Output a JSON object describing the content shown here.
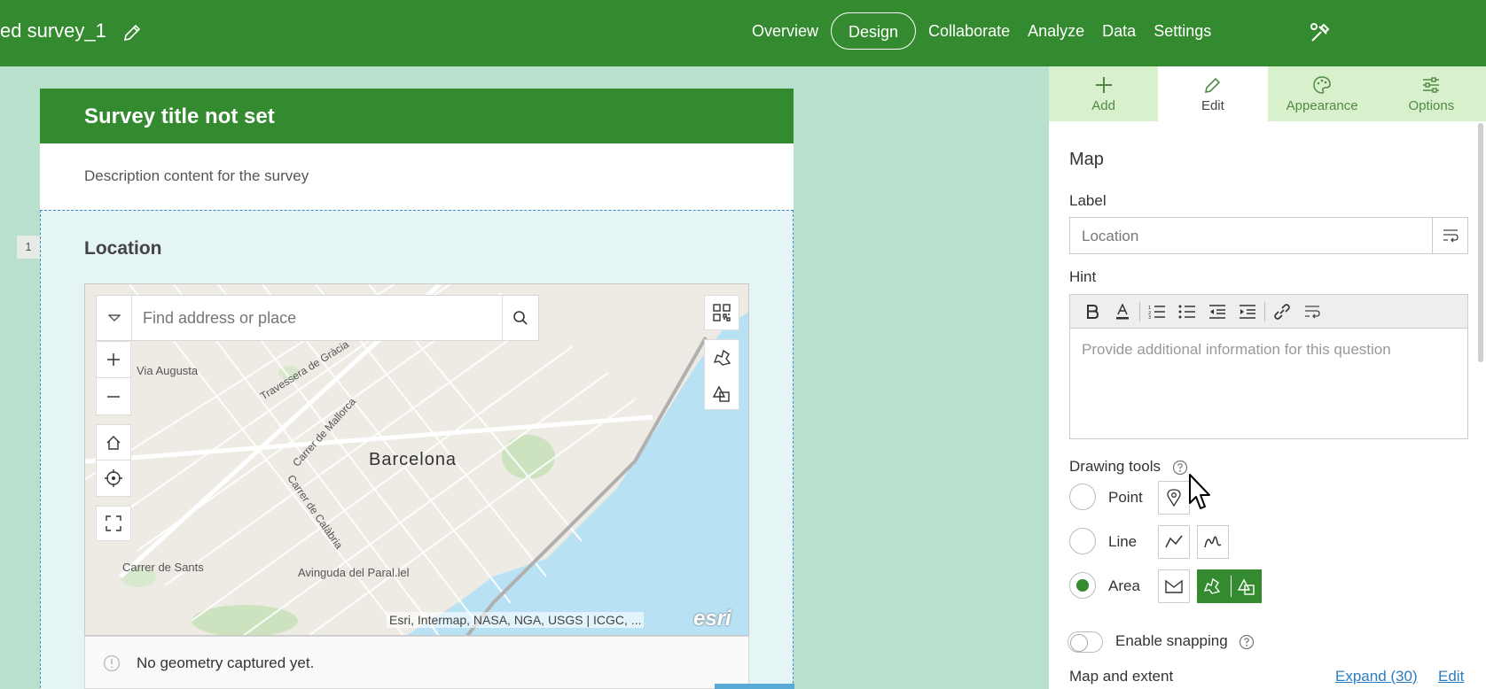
{
  "topbar": {
    "title": "ed survey_1",
    "nav": [
      "Overview",
      "Design",
      "Collaborate",
      "Analyze",
      "Data",
      "Settings"
    ],
    "active_nav": "Design"
  },
  "survey": {
    "title": "Survey title not set",
    "description": "Description content for the survey",
    "question_number": "1",
    "question_label": "Location"
  },
  "map": {
    "search_placeholder": "Find address or place",
    "city": "Barcelona",
    "streets": [
      "Via Augusta",
      "Travessera de Gràcia",
      "Carrer de Mallorca",
      "Carrer de Calàbria",
      "Carrer de Sants",
      "Avinguda del Paral.lel"
    ],
    "attribution": "Esri, Intermap, NASA, NGA, USGS | ICGC, ...",
    "logo": "esri",
    "status": "No geometry captured yet."
  },
  "panel": {
    "tabs": [
      {
        "label": "Add",
        "icon": "plus-icon"
      },
      {
        "label": "Edit",
        "icon": "pencil-icon"
      },
      {
        "label": "Appearance",
        "icon": "palette-icon"
      },
      {
        "label": "Options",
        "icon": "sliders-icon"
      }
    ],
    "active_tab": "Edit",
    "heading": "Map",
    "label_title": "Label",
    "label_value": "Location",
    "hint_title": "Hint",
    "hint_placeholder": "Provide additional information for this question",
    "drawing_tools_title": "Drawing tools",
    "tools": [
      {
        "label": "Point",
        "selected": false
      },
      {
        "label": "Line",
        "selected": false
      },
      {
        "label": "Area",
        "selected": true
      }
    ],
    "snapping_label": "Enable snapping",
    "snapping_enabled": false,
    "map_extent_label": "Map and extent",
    "expand_link": "Expand (30)",
    "edit_link": "Edit"
  },
  "colors": {
    "brand": "#338a2f",
    "link": "#2c7cc0"
  }
}
